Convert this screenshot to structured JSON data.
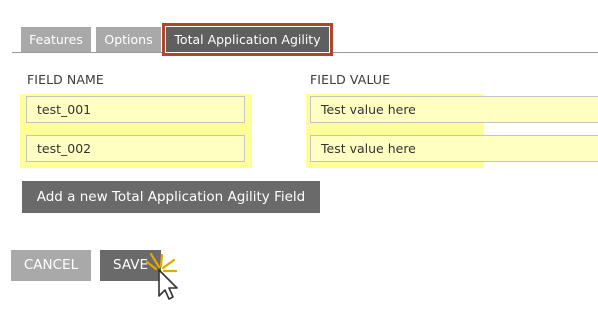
{
  "tabs": [
    {
      "label": "Features",
      "active": false
    },
    {
      "label": "Options",
      "active": false
    },
    {
      "label": "Total Application Agility",
      "active": true
    }
  ],
  "table": {
    "headers": {
      "name": "FIELD NAME",
      "value": "FIELD VALUE"
    },
    "rows": [
      {
        "name": "test_001",
        "value": "Test value here"
      },
      {
        "name": "test_002",
        "value": "Test value here"
      }
    ]
  },
  "buttons": {
    "add": "Add a new Total Application Agility Field",
    "cancel": "CANCEL",
    "save": "SAVE"
  },
  "colors": {
    "highlight": "#ffff99",
    "active_tab_outline": "#b0452d",
    "active_tab": "#5f5f5f",
    "inactive_tab": "#a9a9a9",
    "primary_button": "#6a6a6a"
  },
  "icons": {
    "cursor": "arrow-cursor-icon",
    "click": "click-burst-icon"
  }
}
